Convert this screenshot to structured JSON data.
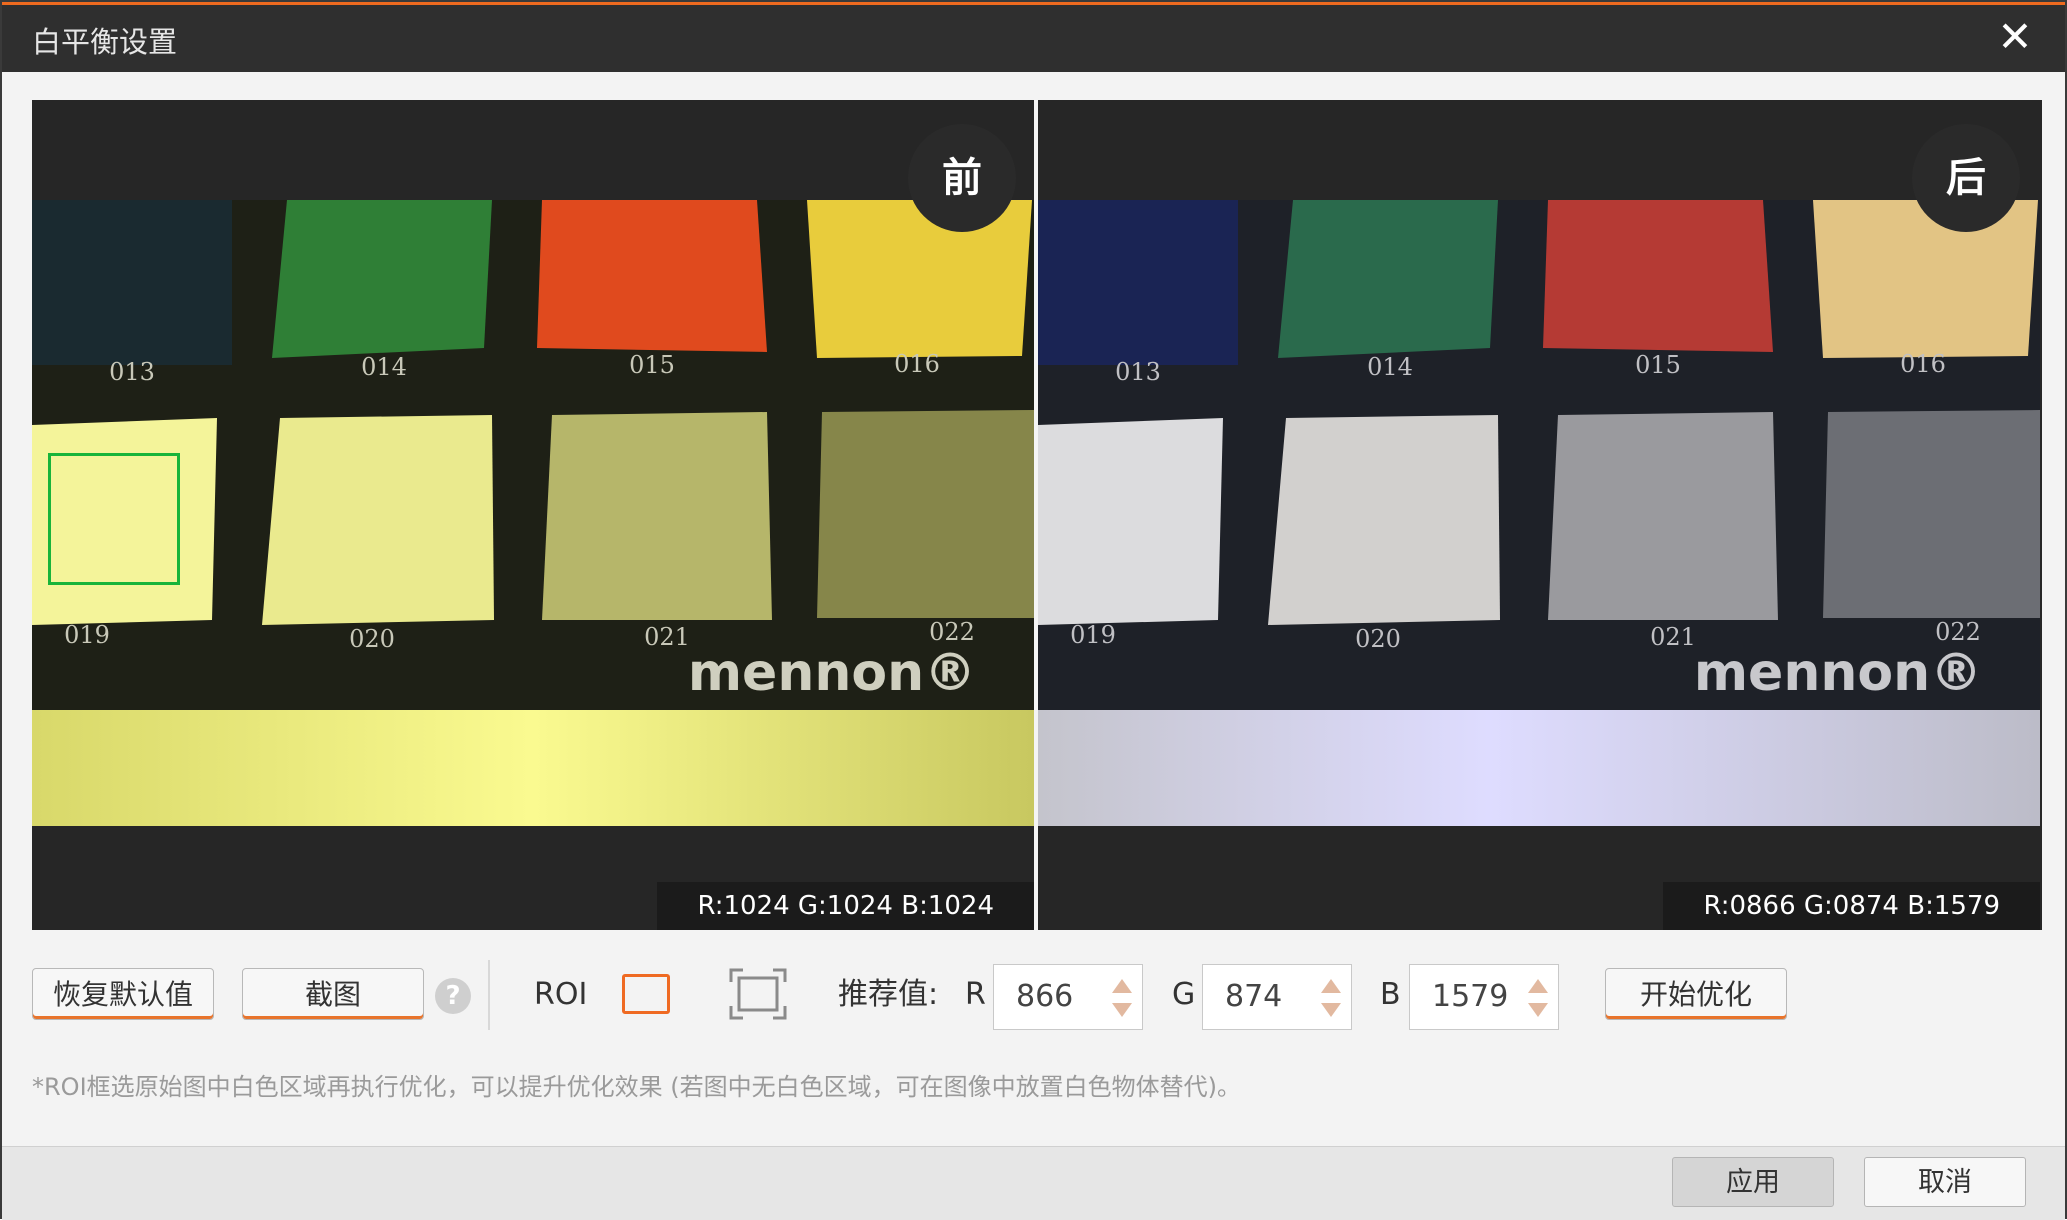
{
  "window": {
    "title": "白平衡设置",
    "close_glyph": "✕"
  },
  "preview": {
    "before": {
      "badge": "前",
      "rgb": "R:1024   G:1024   B:1024"
    },
    "after": {
      "badge": "后",
      "rgb": "R:0866   G:0874   B:1579"
    }
  },
  "chart_labels": {
    "top": [
      "013",
      "014",
      "015",
      "016"
    ],
    "bottom": [
      "019",
      "020",
      "021",
      "022"
    ],
    "brand": "mennon®"
  },
  "toolbar": {
    "reset_label": "恢复默认值",
    "snapshot_label": "截图",
    "help_glyph": "?",
    "roi_label": "ROI",
    "recommended_label": "推荐值:",
    "r_label": "R",
    "g_label": "G",
    "b_label": "B",
    "r_value": "866",
    "g_value": "874",
    "b_value": "1579",
    "optimize_label": "开始优化"
  },
  "note": "*ROI框选原始图中白色区域再执行优化，可以提升优化效果 (若图中无白色区域，可在图像中放置白色物体替代)。",
  "footer": {
    "apply_label": "应用",
    "cancel_label": "取消"
  },
  "colors": {
    "accent": "#ee6a1f",
    "roi_box": "#18b43a",
    "titlebar": "#2f2f2f"
  }
}
